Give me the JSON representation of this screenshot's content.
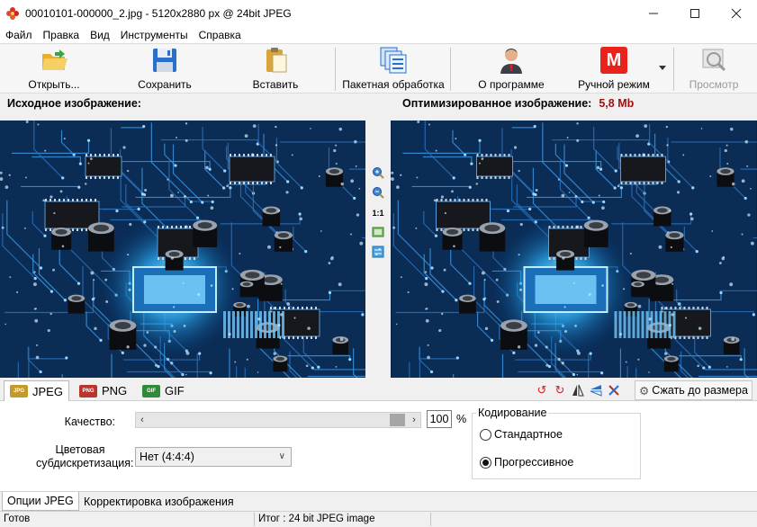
{
  "window": {
    "title": "00010101-000000_2.jpg - 5120x2880 px @ 24bit JPEG",
    "app_icon": "flower-app-icon",
    "controls": [
      "minimize",
      "maximize",
      "close"
    ]
  },
  "menu": {
    "items": [
      "Файл",
      "Правка",
      "Вид",
      "Инструменты",
      "Справка"
    ]
  },
  "toolbar": {
    "open_label": "Открыть...",
    "save_label": "Сохранить",
    "paste_label": "Вставить",
    "batch_label": "Пакетная обработка",
    "about_label": "О программе",
    "manual_label": "Ручной режим",
    "manual_icon_letter": "M",
    "preview_label": "Просмотр",
    "colors": {
      "manual_icon": "#e8231c",
      "open_folder": "#f2c53d",
      "save_disk": "#2a6fc9"
    }
  },
  "panels": {
    "source_title": "Исходное изображение:",
    "optimized_title": "Оптимизированное изображение:",
    "optimized_size": "5,8 Mb",
    "size_color": "#a01010"
  },
  "zoom": {
    "zoom_in_icon": "zoom-in-icon",
    "zoom_out_icon": "zoom-out-icon",
    "actual_size_label": "1:1",
    "fit_icon": "fit-window-icon",
    "swap_icon": "swap-view-icon"
  },
  "formats": {
    "tabs": [
      "JPEG",
      "PNG",
      "GIF"
    ],
    "active": "JPEG",
    "resize_label": "Сжать до размера"
  },
  "options": {
    "quality_label": "Качество:",
    "quality_value": "100",
    "quality_fraction": 1.0,
    "percent_sign": "%",
    "subsampling_label_line1": "Цветовая",
    "subsampling_label_line2": "субдискретизация:",
    "subsampling_value": "Нет (4:4:4)",
    "encoding_title": "Кодирование",
    "encoding_standard": "Стандартное",
    "encoding_progressive": "Прогрессивное",
    "encoding_selected": "progressive"
  },
  "bottom_tabs": {
    "tabs": [
      "Опции JPEG",
      "Корректировка изображения"
    ],
    "active": "Опции JPEG"
  },
  "status": {
    "left": "Готов",
    "right": "Итог : 24 bit JPEG image"
  }
}
